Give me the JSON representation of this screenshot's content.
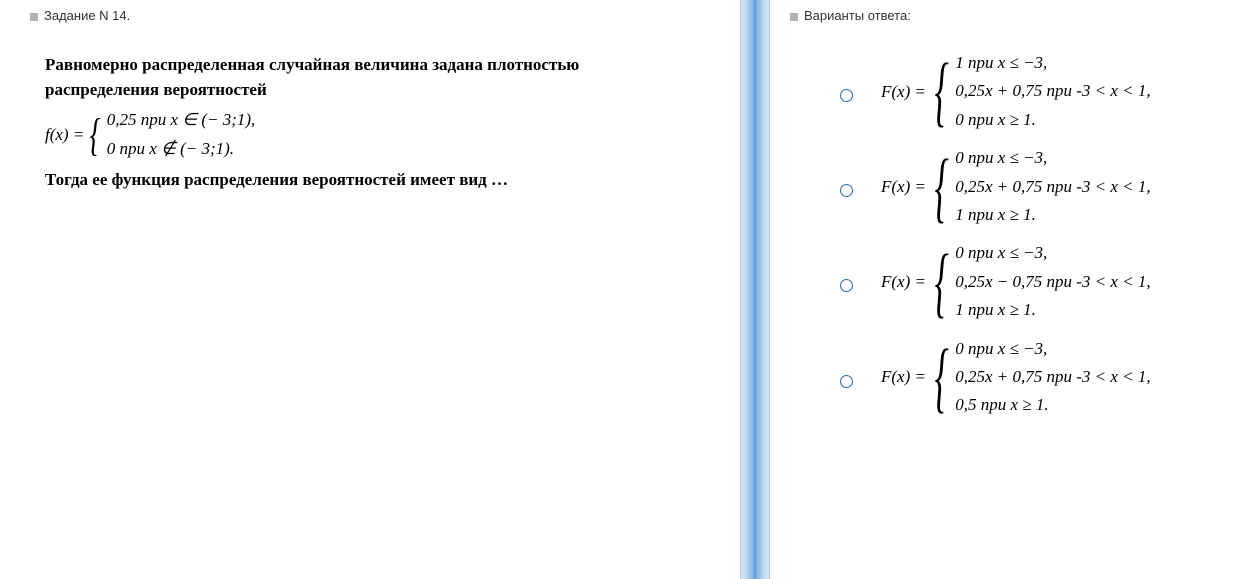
{
  "left": {
    "header": "Задание N 14.",
    "line1": "Равномерно распределенная случайная величина задана плотностью",
    "line2": "распределения вероятностей",
    "formula_lhs": "f(x) =",
    "formula_case1": "0,25  при   x ∈ (− 3;1),",
    "formula_case2": "0    при    x ∉ (− 3;1).",
    "line3": "Тогда ее функция распределения вероятностей имеет вид …"
  },
  "right": {
    "header": "Варианты ответа:",
    "options": [
      {
        "lhs": "F(x) =",
        "c1": "1  при   x ≤ −3,",
        "c2": "0,25x + 0,75   при  -3 < x < 1,",
        "c3": "0   при   x ≥ 1."
      },
      {
        "lhs": "F(x) =",
        "c1": "0  при   x ≤ −3,",
        "c2": "0,25x + 0,75   при  -3 < x < 1,",
        "c3": "1   при   x ≥ 1."
      },
      {
        "lhs": "F(x) =",
        "c1": "0  при   x ≤ −3,",
        "c2": "0,25x − 0,75   при  -3 < x < 1,",
        "c3": "1   при   x ≥ 1."
      },
      {
        "lhs": "F(x) =",
        "c1": "0  при   x ≤ −3,",
        "c2": "0,25x + 0,75   при  -3 < x < 1,",
        "c3": "0,5   при   x ≥ 1."
      }
    ]
  }
}
